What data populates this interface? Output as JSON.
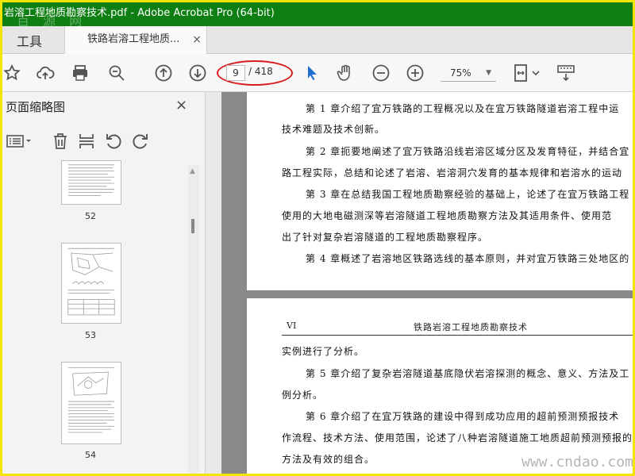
{
  "window": {
    "title": "岩溶工程地质勘察技术.pdf - Adobe Acrobat Pro (64-bit)",
    "watermark_top": "百 源 网"
  },
  "tabs": {
    "tools_label": "工具",
    "document_label": "铁路岩溶工程地质...",
    "close_glyph": "×"
  },
  "toolbar": {
    "icons": [
      "bookmark-star-icon",
      "cloud-upload-icon",
      "print-icon",
      "zoom-search-icon",
      "prev-page-icon",
      "next-page-icon",
      "select-arrow-icon",
      "hand-icon",
      "zoom-out-icon",
      "zoom-in-icon",
      "fit-page-icon",
      "keyboard-icon"
    ],
    "current_page": "9",
    "total_pages": "/ 418",
    "zoom": "75%",
    "highlight_color": "#d81b1b"
  },
  "sidebar": {
    "title": "页面缩略图",
    "close_glyph": "×",
    "tools": [
      "options-icon",
      "delete-icon",
      "insert-page-icon",
      "rotate-ccw-icon",
      "rotate-cw-icon"
    ],
    "thumbnails": [
      {
        "label": "52"
      },
      {
        "label": "53"
      },
      {
        "label": "54"
      }
    ]
  },
  "document": {
    "page1_paragraphs": [
      "第 1 章介绍了宜万铁路的工程概况以及在宜万铁路隧道岩溶工程中运",
      "技术难题及技术创新。",
      "第 2 章扼要地阐述了宜万铁路沿线岩溶区域分区及发育特征，并结合宜",
      "路工程实际，总结和论述了岩溶、岩溶洞穴发育的基本规律和岩溶水的运动",
      "第 3 章在总结我国工程地质勘察经验的基础上，论述了在宜万铁路工程",
      "使用的大地电磁测深等岩溶隧道工程地质勘察方法及其适用条件、使用范",
      "出了针对复杂岩溶隧道的工程地质勘察程序。",
      "第 4 章概述了岩溶地区铁路选线的基本原则，并对宜万铁路三处地区的"
    ],
    "page2_header_left": "VI",
    "page2_header_title": "铁路岩溶工程地质勘察技术",
    "page2_paragraphs": [
      "实例进行了分析。",
      "第 5 章介绍了复杂岩溶隧道基底隐伏岩溶探测的概念、意义、方法及工",
      "例分析。",
      "第 6 章介绍了在宜万铁路的建设中得到成功应用的超前预测预报技术",
      "作流程、技术方法、使用范围，论述了八种岩溶隧道施工地质超前预测预报的",
      "方法及有效的组合。"
    ],
    "watermark_bottom": "www.cndao.com"
  }
}
